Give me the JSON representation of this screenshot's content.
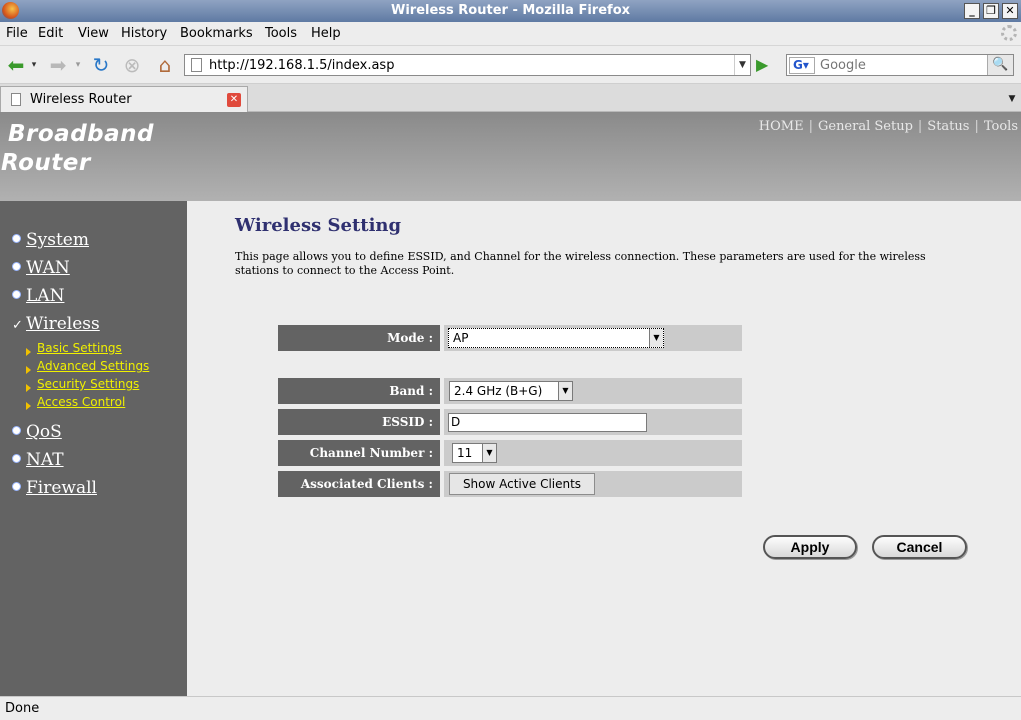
{
  "window": {
    "title": "Wireless Router - Mozilla Firefox"
  },
  "menu": [
    "File",
    "Edit",
    "View",
    "History",
    "Bookmarks",
    "Tools",
    "Help"
  ],
  "toolbar": {
    "url": "http://192.168.1.5/index.asp",
    "search_placeholder": "Google"
  },
  "tab": {
    "label": "Wireless Router"
  },
  "header": {
    "brand_line1": "Broadband",
    "brand_line2": "Router",
    "nav": [
      "HOME",
      "General Setup",
      "Status",
      "Tools"
    ]
  },
  "sidebar": {
    "items": [
      "System",
      "WAN",
      "LAN",
      "Wireless",
      "QoS",
      "NAT",
      "Firewall"
    ],
    "subitems": [
      "Basic Settings",
      "Advanced Settings",
      "Security Settings",
      "Access Control"
    ]
  },
  "content": {
    "title": "Wireless Setting",
    "description": "This page allows you to define ESSID, and Channel for the wireless connection. These parameters are used for the wireless stations to connect to the Access Point.",
    "fields": {
      "mode": {
        "label": "Mode :",
        "value": "AP"
      },
      "band": {
        "label": "Band :",
        "value": "2.4 GHz (B+G)"
      },
      "essid": {
        "label": "ESSID :",
        "value": "D"
      },
      "channel": {
        "label": "Channel Number :",
        "value": "11"
      },
      "clients": {
        "label": "Associated Clients :",
        "button": "Show Active Clients"
      }
    },
    "apply": "Apply",
    "cancel": "Cancel"
  },
  "status": {
    "text": "Done"
  }
}
